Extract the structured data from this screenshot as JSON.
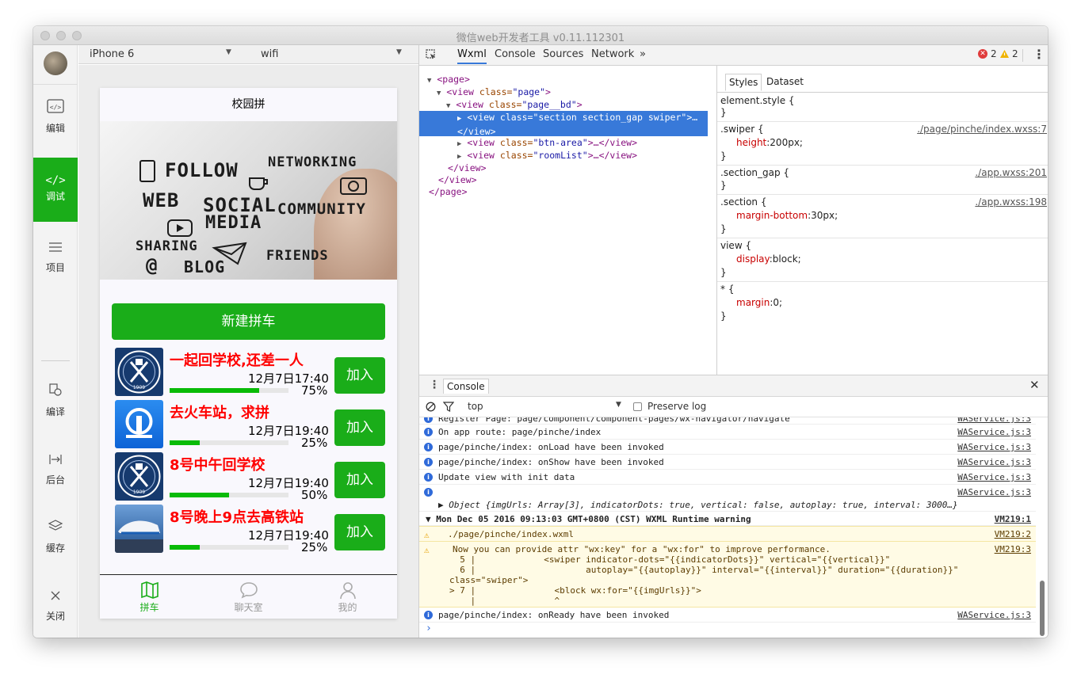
{
  "window": {
    "title": "微信web开发者工具 v0.11.112301"
  },
  "sidebar": {
    "items": [
      {
        "label": "编辑",
        "icon": "code-icon"
      },
      {
        "label": "调试",
        "icon": "debug-icon"
      },
      {
        "label": "项目",
        "icon": "menu-icon"
      },
      {
        "label": "编译",
        "icon": "compile-icon"
      },
      {
        "label": "后台",
        "icon": "background-icon"
      },
      {
        "label": "缓存",
        "icon": "layers-icon"
      },
      {
        "label": "关闭",
        "icon": "close-icon"
      }
    ]
  },
  "simulator": {
    "device": "iPhone 6",
    "network": "wifi"
  },
  "phone": {
    "nav_title": "校园拼",
    "banner_words": [
      "FOLLOW",
      "NETWORKING",
      "WEB",
      "SOCIAL",
      "MEDIA",
      "COMMUNITY",
      "SHARING",
      "BLOG",
      "FRIENDS",
      "@"
    ],
    "new_button": "新建拼车",
    "rooms": [
      {
        "title": "一起回学校,还差一人",
        "time": "12月7日17:40",
        "percent_label": "75%",
        "progress": 0.75,
        "join": "加入",
        "thumb": "school-logo"
      },
      {
        "title": "去火车站，求拼",
        "time": "12月7日19:40",
        "percent_label": "25%",
        "progress": 0.25,
        "join": "加入",
        "thumb": "railway-logo"
      },
      {
        "title": "8号中午回学校",
        "time": "12月7日19:40",
        "percent_label": "50%",
        "progress": 0.5,
        "join": "加入",
        "thumb": "school-logo"
      },
      {
        "title": "8号晚上9点去高铁站",
        "time": "12月7日19:40",
        "percent_label": "25%",
        "progress": 0.25,
        "join": "加入",
        "thumb": "train-photo"
      }
    ],
    "tabs": [
      {
        "label": "拼车",
        "icon": "map-icon",
        "active": true
      },
      {
        "label": "聊天室",
        "icon": "chat-icon",
        "active": false
      },
      {
        "label": "我的",
        "icon": "user-icon",
        "active": false
      }
    ]
  },
  "devtools": {
    "tabs": [
      "Wxml",
      "Console",
      "Sources",
      "Network"
    ],
    "more": "»",
    "errors": "2",
    "warnings": "2",
    "elements": [
      {
        "tag": "page",
        "attr": "",
        "val": "",
        "suffix": "",
        "kind": "open"
      },
      {
        "tag": "view",
        "attr": "class=",
        "val": "\"page\"",
        "suffix": ">",
        "kind": "open"
      },
      {
        "tag": "view",
        "attr": "class=",
        "val": "\"page__bd\"",
        "suffix": ">",
        "kind": "open"
      },
      {
        "tag": "view",
        "attr": "class=",
        "val": "\"section section_gap swiper\"",
        "suffix": ">…",
        "kind": "open"
      },
      {
        "tag": "/view",
        "attr": "",
        "val": "",
        "suffix": "",
        "kind": "close"
      },
      {
        "tag": "view",
        "attr": "class=",
        "val": "\"btn-area\"",
        "suffix": ">…</view>",
        "kind": "open"
      },
      {
        "tag": "view",
        "attr": "class=",
        "val": "\"roomList\"",
        "suffix": ">…</view>",
        "kind": "open"
      },
      {
        "tag": "/view",
        "attr": "",
        "val": "",
        "suffix": "",
        "kind": "close"
      },
      {
        "tag": "/view",
        "attr": "",
        "val": "",
        "suffix": "",
        "kind": "close"
      },
      {
        "tag": "/page",
        "attr": "",
        "val": "",
        "suffix": "",
        "kind": "close"
      }
    ],
    "styles_tabs": [
      "Styles",
      "Dataset"
    ],
    "rules": [
      {
        "selector": "element.style {",
        "source": "",
        "decls": []
      },
      {
        "selector": ".swiper {",
        "source": "./page/pinche/index.wxss:7",
        "decls": [
          {
            "p": "height",
            "v": "200px;"
          }
        ]
      },
      {
        "selector": ".section_gap {",
        "source": "./app.wxss:201",
        "decls": []
      },
      {
        "selector": ".section {",
        "source": "./app.wxss:198",
        "decls": [
          {
            "p": "margin-bottom",
            "v": "30px;"
          }
        ]
      },
      {
        "selector": "view {",
        "source": "",
        "decls": [
          {
            "p": "display",
            "v": "block;"
          }
        ]
      },
      {
        "selector": "* {",
        "source": "",
        "decls": [
          {
            "p": "margin",
            "v": "0;"
          }
        ]
      }
    ],
    "console": {
      "tab": "Console",
      "filter": "top",
      "preserve_log": "Preserve log",
      "lines": [
        {
          "type": "info",
          "text": "Register Page: page/component/component-pages/wx-navigator/navigate",
          "src": "WAService.js:3"
        },
        {
          "type": "info",
          "text": "On app route: page/pinche/index",
          "src": "WAService.js:3"
        },
        {
          "type": "info",
          "text": "page/pinche/index: onLoad have been invoked",
          "src": "WAService.js:3"
        },
        {
          "type": "info",
          "text": "page/pinche/index: onShow have been invoked",
          "src": "WAService.js:3"
        },
        {
          "type": "info",
          "text": "Update view with init data",
          "src": "WAService.js:3"
        },
        {
          "type": "info",
          "text": "",
          "src": "WAService.js:3"
        },
        {
          "type": "object",
          "text": "▶ Object {imgUrls: Array[3], indicatorDots: true, vertical: false, autoplay: true, interval: 3000…}",
          "src": ""
        },
        {
          "type": "group",
          "text": "▼ Mon Dec 05 2016 09:13:03 GMT+0800 (CST) WXML Runtime warning",
          "src": "VM219:1"
        },
        {
          "type": "warn",
          "text": "./page/pinche/index.wxml",
          "src": "VM219:2"
        },
        {
          "type": "warn",
          "text": "Now you can provide attr \"wx:key\" for a \"wx:for\" to improve performance.",
          "src": "VM219:3"
        },
        {
          "type": "code",
          "text": "  5 |             <swiper indicator-dots=\"{{indicatorDots}}\" vertical=\"{{vertical}}\"",
          "src": ""
        },
        {
          "type": "code",
          "text": "  6 |                     autoplay=\"{{autoplay}}\" interval=\"{{interval}}\" duration=\"{{duration}}\"",
          "src": ""
        },
        {
          "type": "code",
          "text": "class=\"swiper\">",
          "src": ""
        },
        {
          "type": "code",
          "text": "> 7 |               <block wx:for=\"{{imgUrls}}\">",
          "src": ""
        },
        {
          "type": "code",
          "text": "    |               ^",
          "src": ""
        },
        {
          "type": "info",
          "text": "page/pinche/index: onReady have been invoked",
          "src": "WAService.js:3"
        }
      ],
      "prompt": "›"
    }
  }
}
